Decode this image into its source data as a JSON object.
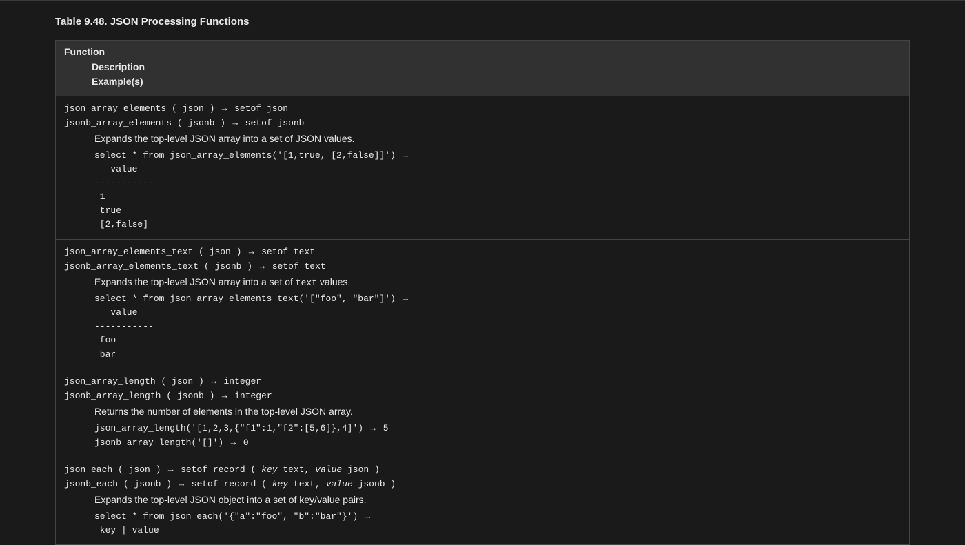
{
  "title": "Table 9.48. JSON Processing Functions",
  "header": {
    "function": "Function",
    "description": "Description",
    "examples": "Example(s)"
  },
  "rows": [
    {
      "sigs": [
        {
          "name": "json_array_elements",
          "arg": "json",
          "ret": "setof json"
        },
        {
          "name": "jsonb_array_elements",
          "arg": "jsonb",
          "ret": "setof jsonb"
        }
      ],
      "desc_plain": "Expands the top-level JSON array into a set of JSON values.",
      "examples": [
        {
          "call": "select * from json_array_elements('[1,true, [2,false]]')",
          "result_block": "   value\n-----------\n 1\n true\n [2,false]"
        }
      ]
    },
    {
      "sigs": [
        {
          "name": "json_array_elements_text",
          "arg": "json",
          "ret": "setof text"
        },
        {
          "name": "jsonb_array_elements_text",
          "arg": "jsonb",
          "ret": "setof text"
        }
      ],
      "desc_pre": "Expands the top-level JSON array into a set of ",
      "desc_lit": "text",
      "desc_post": " values.",
      "examples": [
        {
          "call": "select * from json_array_elements_text('[\"foo\", \"bar\"]')",
          "result_block": "   value\n-----------\n foo\n bar"
        }
      ]
    },
    {
      "sigs": [
        {
          "name": "json_array_length",
          "arg": "json",
          "ret": "integer"
        },
        {
          "name": "jsonb_array_length",
          "arg": "jsonb",
          "ret": "integer"
        }
      ],
      "desc_plain": "Returns the number of elements in the top-level JSON array.",
      "examples": [
        {
          "call": "json_array_length('[1,2,3,{\"f1\":1,\"f2\":[5,6]},4]')",
          "result_inline": "5"
        },
        {
          "call": "jsonb_array_length('[]')",
          "result_inline": "0"
        }
      ]
    },
    {
      "sigs": [
        {
          "name": "json_each",
          "arg": "json",
          "record": true,
          "val_type": "json"
        },
        {
          "name": "jsonb_each",
          "arg": "jsonb",
          "record": true,
          "val_type": "jsonb"
        }
      ],
      "desc_plain": "Expands the top-level JSON object into a set of key/value pairs.",
      "examples": [
        {
          "call": "select * from json_each('{\"a\":\"foo\", \"b\":\"bar\"}')",
          "result_block": " key | value"
        }
      ]
    }
  ],
  "tok": {
    "arrow": "→",
    "setof_record": "setof record",
    "key": "key",
    "value": "value",
    "text_t": "text",
    "lp": " ( ",
    "rp": " )",
    "comma": ", "
  }
}
